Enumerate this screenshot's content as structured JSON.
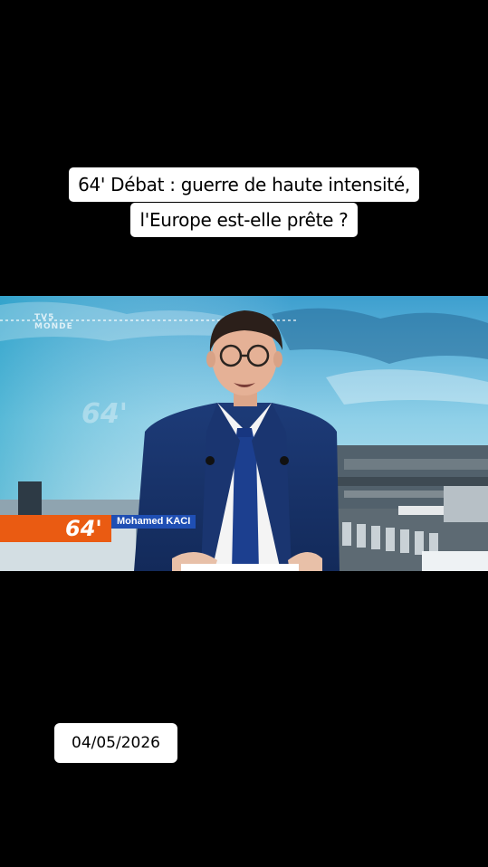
{
  "caption": {
    "line1": "64' Débat : guerre de haute intensité,",
    "line2": "l'Europe est-elle prête ?"
  },
  "video": {
    "channel_logo_line1": "TV5",
    "channel_logo_line2": "MONDE",
    "background_logo": "64'",
    "lower_third": {
      "logo": "64'",
      "presenter_name": "Mohamed KACI",
      "logo_color": "#ea5b12",
      "name_color": "#1f4fb4"
    }
  },
  "date_overlay": "04/05/2026"
}
